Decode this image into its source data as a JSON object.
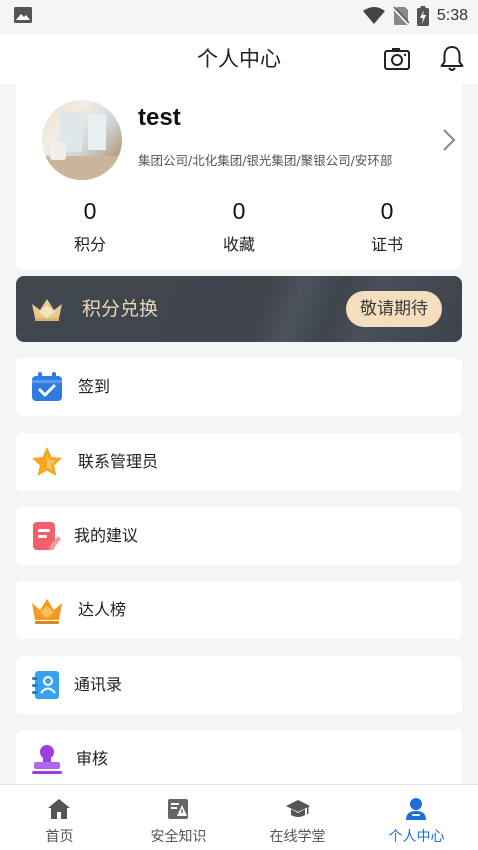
{
  "status_bar": {
    "time": "5:38"
  },
  "header": {
    "title": "个人中心"
  },
  "profile": {
    "username": "test",
    "organization": "集团公司/北化集团/银光集团/聚银公司/安环部",
    "stats": [
      {
        "value": "0",
        "label": "积分"
      },
      {
        "value": "0",
        "label": "收藏"
      },
      {
        "value": "0",
        "label": "证书"
      }
    ]
  },
  "points_banner": {
    "title": "积分兑换",
    "button_label": "敬请期待"
  },
  "menu": [
    {
      "label": "签到",
      "icon": "calendar-check-icon"
    },
    {
      "label": "联系管理员",
      "icon": "star-icon"
    },
    {
      "label": "我的建议",
      "icon": "suggestion-note-icon"
    },
    {
      "label": "达人榜",
      "icon": "crown-icon"
    },
    {
      "label": "通讯录",
      "icon": "contacts-book-icon"
    },
    {
      "label": "审核",
      "icon": "stamp-icon"
    }
  ],
  "bottom_nav": [
    {
      "label": "首页",
      "icon": "home-icon",
      "active": false
    },
    {
      "label": "安全知识",
      "icon": "safety-knowledge-icon",
      "active": false
    },
    {
      "label": "在线学堂",
      "icon": "graduation-cap-icon",
      "active": false
    },
    {
      "label": "个人中心",
      "icon": "person-icon",
      "active": true
    }
  ],
  "colors": {
    "accent": "#1a6fd8",
    "banner_bg": "#41464f",
    "banner_text": "#e9d7b6",
    "banner_button": "#f3dfbd"
  }
}
